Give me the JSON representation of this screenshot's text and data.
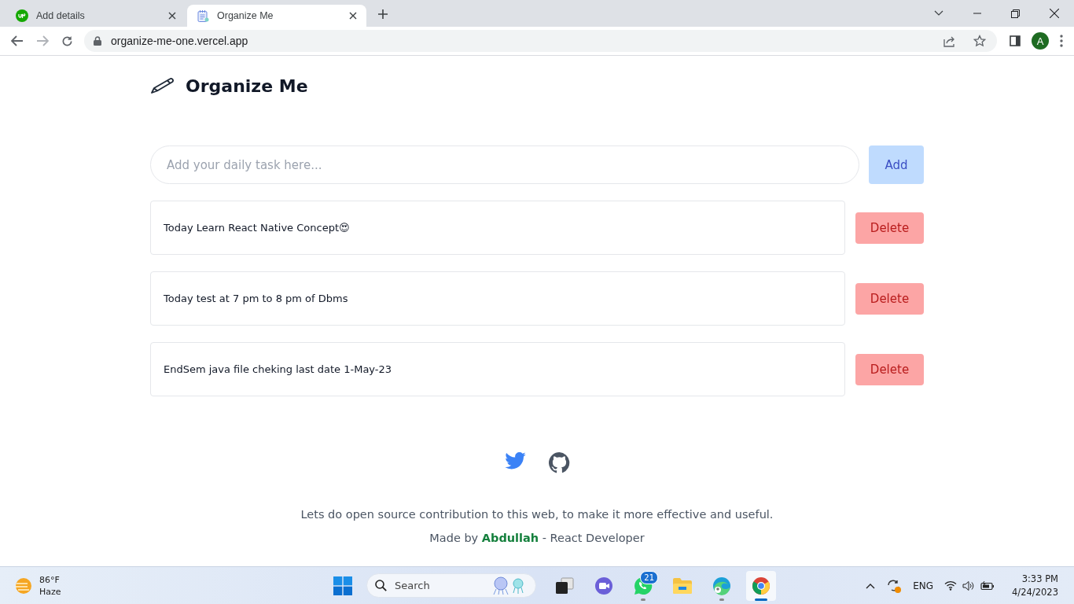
{
  "browser": {
    "tabs": [
      {
        "title": "Add details",
        "kind": "upwork",
        "selected": false
      },
      {
        "title": "Organize Me",
        "kind": "notepad",
        "selected": true
      }
    ],
    "address": "organize-me-one.vercel.app",
    "profile_initial": "A"
  },
  "app": {
    "title": "Organize Me",
    "input": {
      "placeholder": "Add your daily task here..."
    },
    "add_button": "Add",
    "tasks": [
      {
        "text": "Today Learn React Native Concept😍",
        "delete_label": "Delete"
      },
      {
        "text": "Today test at 7 pm to 8 pm of Dbms",
        "delete_label": "Delete"
      },
      {
        "text": "EndSem java file cheking last date 1-May-23",
        "delete_label": "Delete"
      }
    ],
    "footer": {
      "message": "Lets do open source contribution to this web, to make it more effective and useful.",
      "credit": "Made by **Abdullah** - React Developer"
    }
  },
  "taskbar": {
    "weather": {
      "temperature": "86°F",
      "condition": "Haze"
    },
    "search": {
      "placeholder": "Search"
    },
    "apps": [
      {
        "kind": "task-view",
        "open": false,
        "selected": false
      },
      {
        "kind": "chat",
        "open": false,
        "selected": false
      },
      {
        "kind": "whatsapp",
        "badge": "21",
        "open": true,
        "selected": false
      },
      {
        "kind": "files",
        "open": false,
        "selected": false
      },
      {
        "kind": "edge",
        "open": true,
        "selected": false
      },
      {
        "kind": "chrome",
        "open": true,
        "selected": true
      }
    ],
    "language": "ENG",
    "time": "3:33 PM",
    "date": "4/24/2023"
  }
}
